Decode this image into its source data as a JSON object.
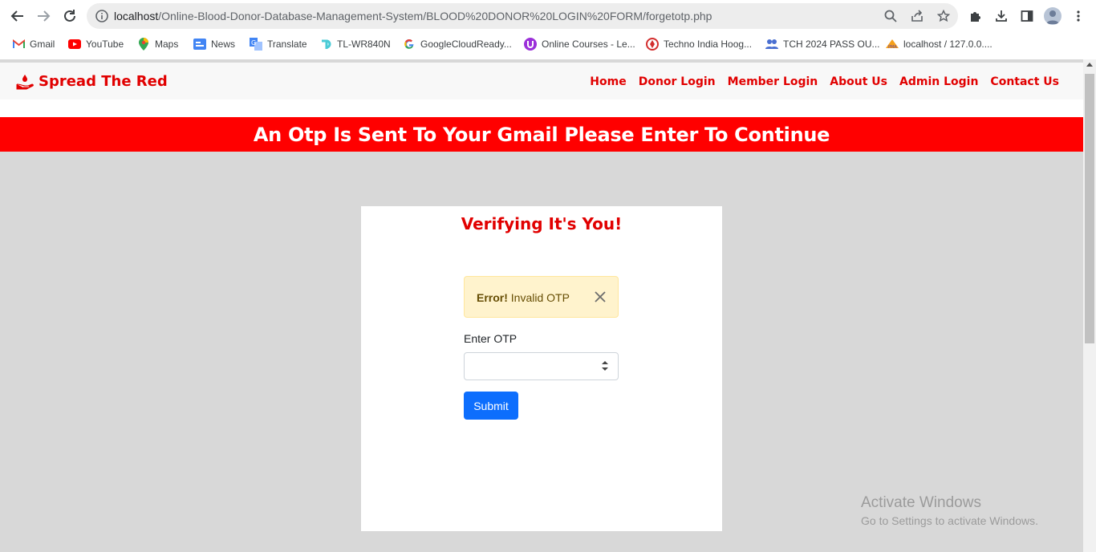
{
  "browser": {
    "url_host": "localhost",
    "url_path": "/Online-Blood-Donor-Database-Management-System/BLOOD%20DONOR%20LOGIN%20FORM/forgetotp.php",
    "bookmarks": [
      {
        "label": "Gmail",
        "icon": "gmail-icon"
      },
      {
        "label": "YouTube",
        "icon": "youtube-icon"
      },
      {
        "label": "Maps",
        "icon": "maps-icon"
      },
      {
        "label": "News",
        "icon": "news-icon"
      },
      {
        "label": "Translate",
        "icon": "translate-icon"
      },
      {
        "label": "TL-WR840N",
        "icon": "tplink-icon"
      },
      {
        "label": "GoogleCloudReady...",
        "icon": "google-icon"
      },
      {
        "label": "Online Courses - Le...",
        "icon": "courses-icon"
      },
      {
        "label": "Techno India Hoog...",
        "icon": "techno-icon"
      },
      {
        "label": "TCH 2024 PASS OU...",
        "icon": "group-icon"
      },
      {
        "label": "localhost / 127.0.0....",
        "icon": "pma-icon"
      }
    ]
  },
  "site": {
    "brand": "Spread The Red",
    "nav": [
      "Home",
      "Donor Login",
      "Member Login",
      "About Us",
      "Admin Login",
      "Contact Us"
    ]
  },
  "banner": {
    "text": "An Otp Is Sent To Your Gmail Please Enter To Continue"
  },
  "card": {
    "title": "Verifying It's You!",
    "alert_strong": "Error!",
    "alert_text": " Invalid OTP",
    "otp_label": "Enter OTP",
    "otp_value": "",
    "submit_label": "Submit"
  },
  "watermark": {
    "line1": "Activate Windows",
    "line2": "Go to Settings to activate Windows."
  },
  "colors": {
    "brand_red": "#e10000",
    "banner_red": "#ff0000",
    "alert_bg": "#fff3cd",
    "button_blue": "#0d6efd"
  }
}
